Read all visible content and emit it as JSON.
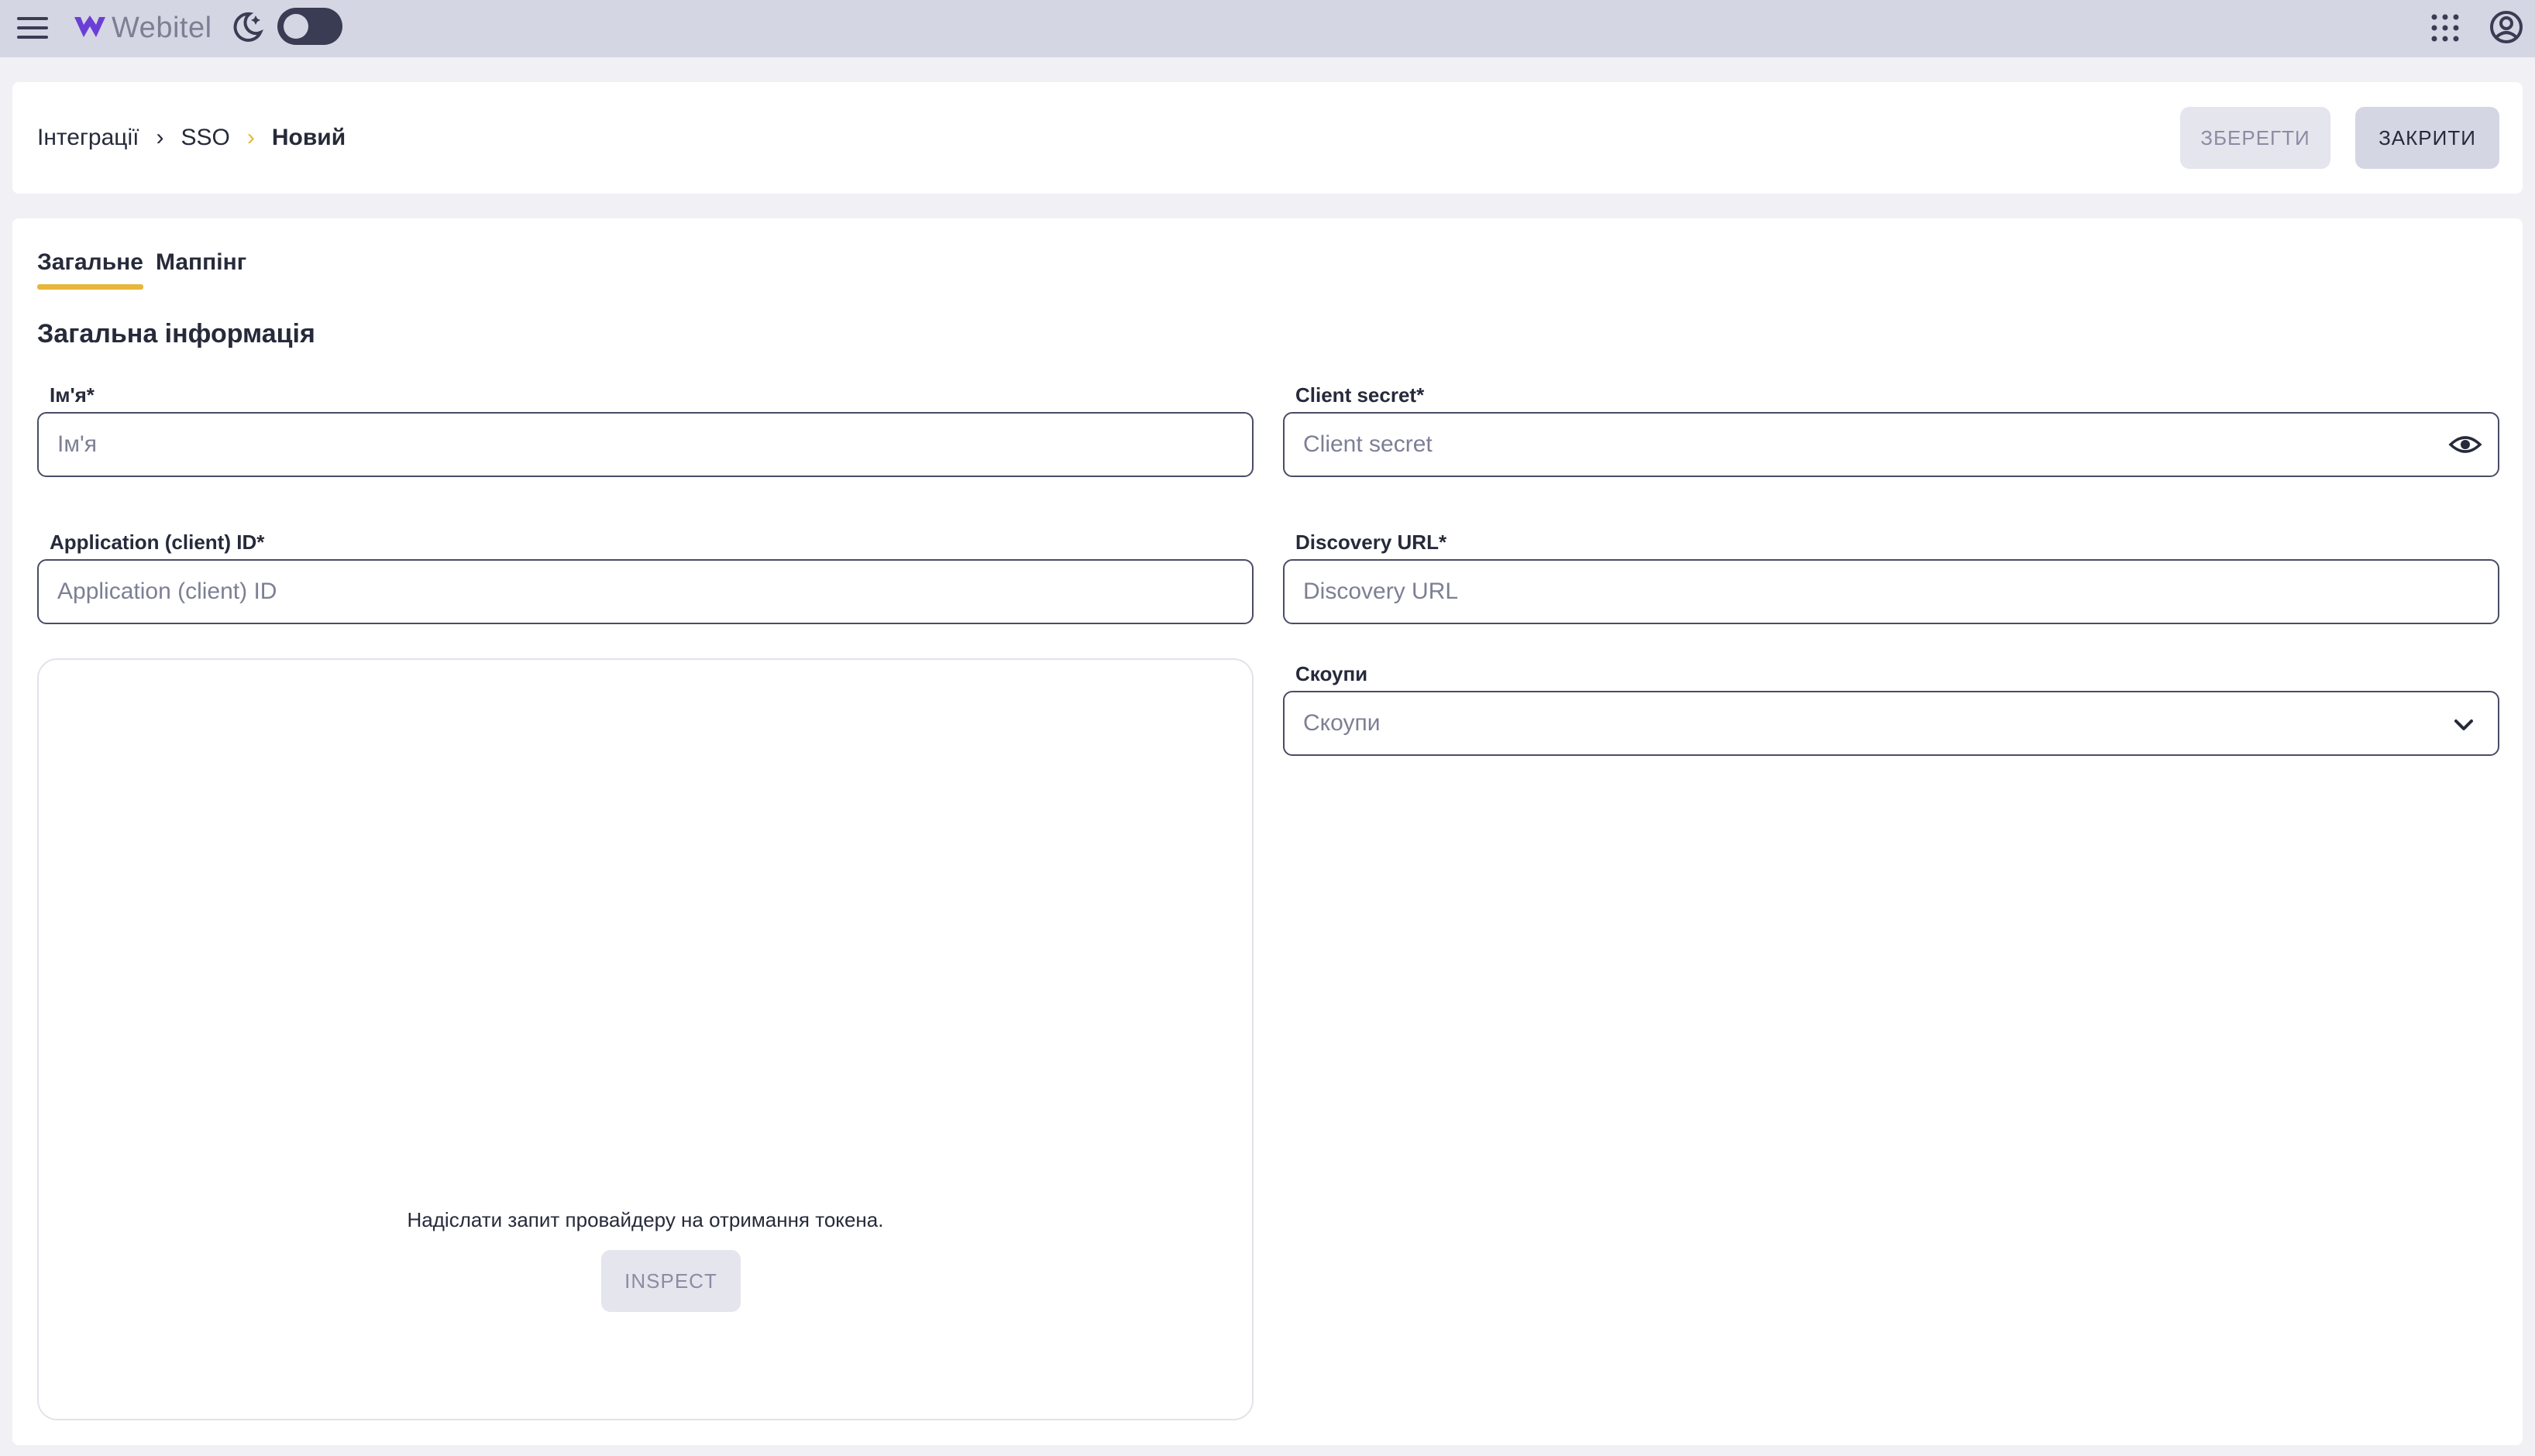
{
  "app": {
    "logo_text": "Webitel"
  },
  "icons": {
    "menu": "hamburger-menu-icon",
    "logo": "webitel-logo-icon",
    "moon": "moon-icon",
    "apps": "apps-grid-icon",
    "account": "account-circle-icon",
    "eye": "eye-icon",
    "chevron": "chevron-down-icon"
  },
  "colors": {
    "topbar": "#d5d6e3",
    "accent": "#e8b63a",
    "text": "#262a3a",
    "muted": "#7d7f94"
  },
  "breadcrumb": {
    "items": [
      "Інтеграції",
      "SSO",
      "Новий"
    ]
  },
  "header": {
    "save_label": "ЗБЕРЕГТИ",
    "close_label": "ЗАКРИТИ"
  },
  "tabs": [
    {
      "label": "Загальне",
      "active": true
    },
    {
      "label": "Маппінг",
      "active": false
    }
  ],
  "section": {
    "title": "Загальна інформація"
  },
  "form": {
    "name": {
      "label": "Ім'я*",
      "placeholder": "Ім'я",
      "value": ""
    },
    "client_secret": {
      "label": "Client secret*",
      "placeholder": "Client secret",
      "value": ""
    },
    "client_id": {
      "label": "Application (client) ID*",
      "placeholder": "Application (client) ID",
      "value": ""
    },
    "discovery_url": {
      "label": "Discovery URL*",
      "placeholder": "Discovery URL",
      "value": ""
    },
    "scopes": {
      "label": "Скоупи",
      "placeholder": "Скоупи"
    }
  },
  "inspect": {
    "text": "Надіслати запит провайдеру на отримання токена.",
    "button_label": "INSPECT"
  }
}
